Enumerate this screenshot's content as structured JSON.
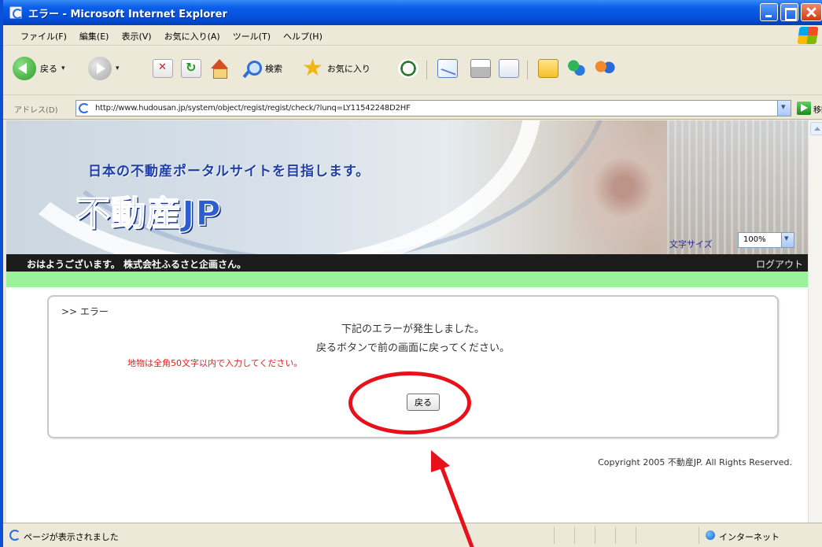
{
  "window": {
    "title": "エラー - Microsoft Internet Explorer"
  },
  "menu": {
    "items": [
      "ファイル(F)",
      "編集(E)",
      "表示(V)",
      "お気に入り(A)",
      "ツール(T)",
      "ヘルプ(H)"
    ]
  },
  "toolbar": {
    "back_label": "戻る",
    "search_label": "検索",
    "favorites_label": "お気に入り"
  },
  "address": {
    "label": "アドレス(D)",
    "url": "http://www.hudousan.jp/system/object/regist/regist/check/?lunq=LY11542248D2HF",
    "go_label": "移動"
  },
  "site": {
    "tagline": "日本の不動産ポータルサイトを目指します。",
    "logo": "不動産JP",
    "font_size_label": "文字サイズ",
    "font_size_value": "100%",
    "greeting": "おはようございます。 株式会社ふるさと企画さん。",
    "logout": "ログアウト"
  },
  "error": {
    "heading": ">> エラー",
    "line1": "下記のエラーが発生しました。",
    "line2": "戻るボタンで前の画面に戻ってください。",
    "detail": "地物は全角50文字以内で入力してください。",
    "back_button": "戻る"
  },
  "footer": {
    "copyright": "Copyright 2005 不動産JP. All Rights Reserved."
  },
  "status": {
    "text": "ページが表示されました",
    "zone": "インターネット"
  },
  "colors": {
    "titlebar": "#0a5ee8",
    "green_bar": "#9cf29c",
    "error_text": "#e0201c",
    "annotation": "#e8101a"
  },
  "icons": [
    "ie-icon",
    "minimize-icon",
    "maximize-icon",
    "close-icon",
    "windows-logo-icon",
    "back-icon",
    "forward-icon",
    "stop-icon",
    "refresh-icon",
    "home-icon",
    "search-icon",
    "favorites-star-icon",
    "history-icon",
    "mail-icon",
    "print-icon",
    "edit-icon",
    "folder-icon",
    "messenger-icon",
    "people-icon",
    "go-icon",
    "globe-icon"
  ]
}
